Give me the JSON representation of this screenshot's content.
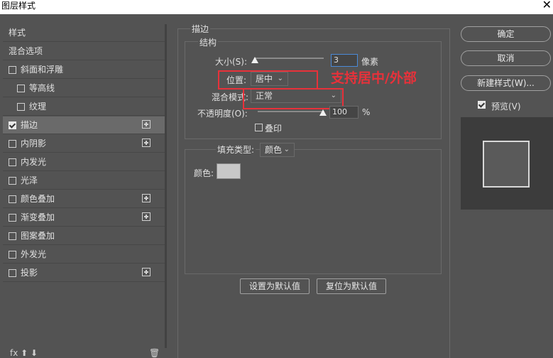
{
  "window": {
    "title": "图层样式",
    "close_glyph": "✕"
  },
  "styles_list": {
    "items": [
      {
        "label": "样式",
        "checkbox": false,
        "checked": false,
        "plus": false,
        "selected": false
      },
      {
        "label": "混合选项",
        "checkbox": false,
        "checked": false,
        "plus": false,
        "selected": false
      },
      {
        "label": "斜面和浮雕",
        "checkbox": true,
        "checked": false,
        "plus": false,
        "selected": false
      },
      {
        "label": "等高线",
        "checkbox": true,
        "checked": false,
        "plus": false,
        "selected": false,
        "indent": true
      },
      {
        "label": "纹理",
        "checkbox": true,
        "checked": false,
        "plus": false,
        "selected": false,
        "indent": true
      },
      {
        "label": "描边",
        "checkbox": true,
        "checked": true,
        "plus": true,
        "selected": true
      },
      {
        "label": "内阴影",
        "checkbox": true,
        "checked": false,
        "plus": true,
        "selected": false
      },
      {
        "label": "内发光",
        "checkbox": true,
        "checked": false,
        "plus": false,
        "selected": false
      },
      {
        "label": "光泽",
        "checkbox": true,
        "checked": false,
        "plus": false,
        "selected": false
      },
      {
        "label": "颜色叠加",
        "checkbox": true,
        "checked": false,
        "plus": true,
        "selected": false
      },
      {
        "label": "渐变叠加",
        "checkbox": true,
        "checked": false,
        "plus": true,
        "selected": false
      },
      {
        "label": "图案叠加",
        "checkbox": true,
        "checked": false,
        "plus": false,
        "selected": false
      },
      {
        "label": "外发光",
        "checkbox": true,
        "checked": false,
        "plus": false,
        "selected": false
      },
      {
        "label": "投影",
        "checkbox": true,
        "checked": false,
        "plus": true,
        "selected": false
      }
    ],
    "bottom_icons": "fx  ⬆  ⬇",
    "trash_icon": "🗑"
  },
  "stroke": {
    "section_title": "描边",
    "structure_title": "结构",
    "size_label": "大小(S):",
    "size_value": "3",
    "size_unit": "像素",
    "position_label": "位置:",
    "position_value": "居中",
    "blend_label": "混合模式:",
    "blend_value": "正常",
    "opacity_label": "不透明度(O):",
    "opacity_value": "100",
    "opacity_unit": "%",
    "overprint_label": "叠印",
    "fill_type_label": "填充类型:",
    "fill_type_value": "颜色",
    "color_label": "颜色:",
    "color_value": "#c8c8c8",
    "set_default_label": "设置为默认值",
    "reset_default_label": "复位为默认值",
    "annotation_text": "支持居中/外部"
  },
  "actions": {
    "ok_label": "确定",
    "cancel_label": "取消",
    "new_style_label": "新建样式(W)...",
    "preview_label": "预览(V)",
    "preview_checked": true
  },
  "colors": {
    "accent_red": "#e8313a",
    "panel_bg": "#535353"
  }
}
